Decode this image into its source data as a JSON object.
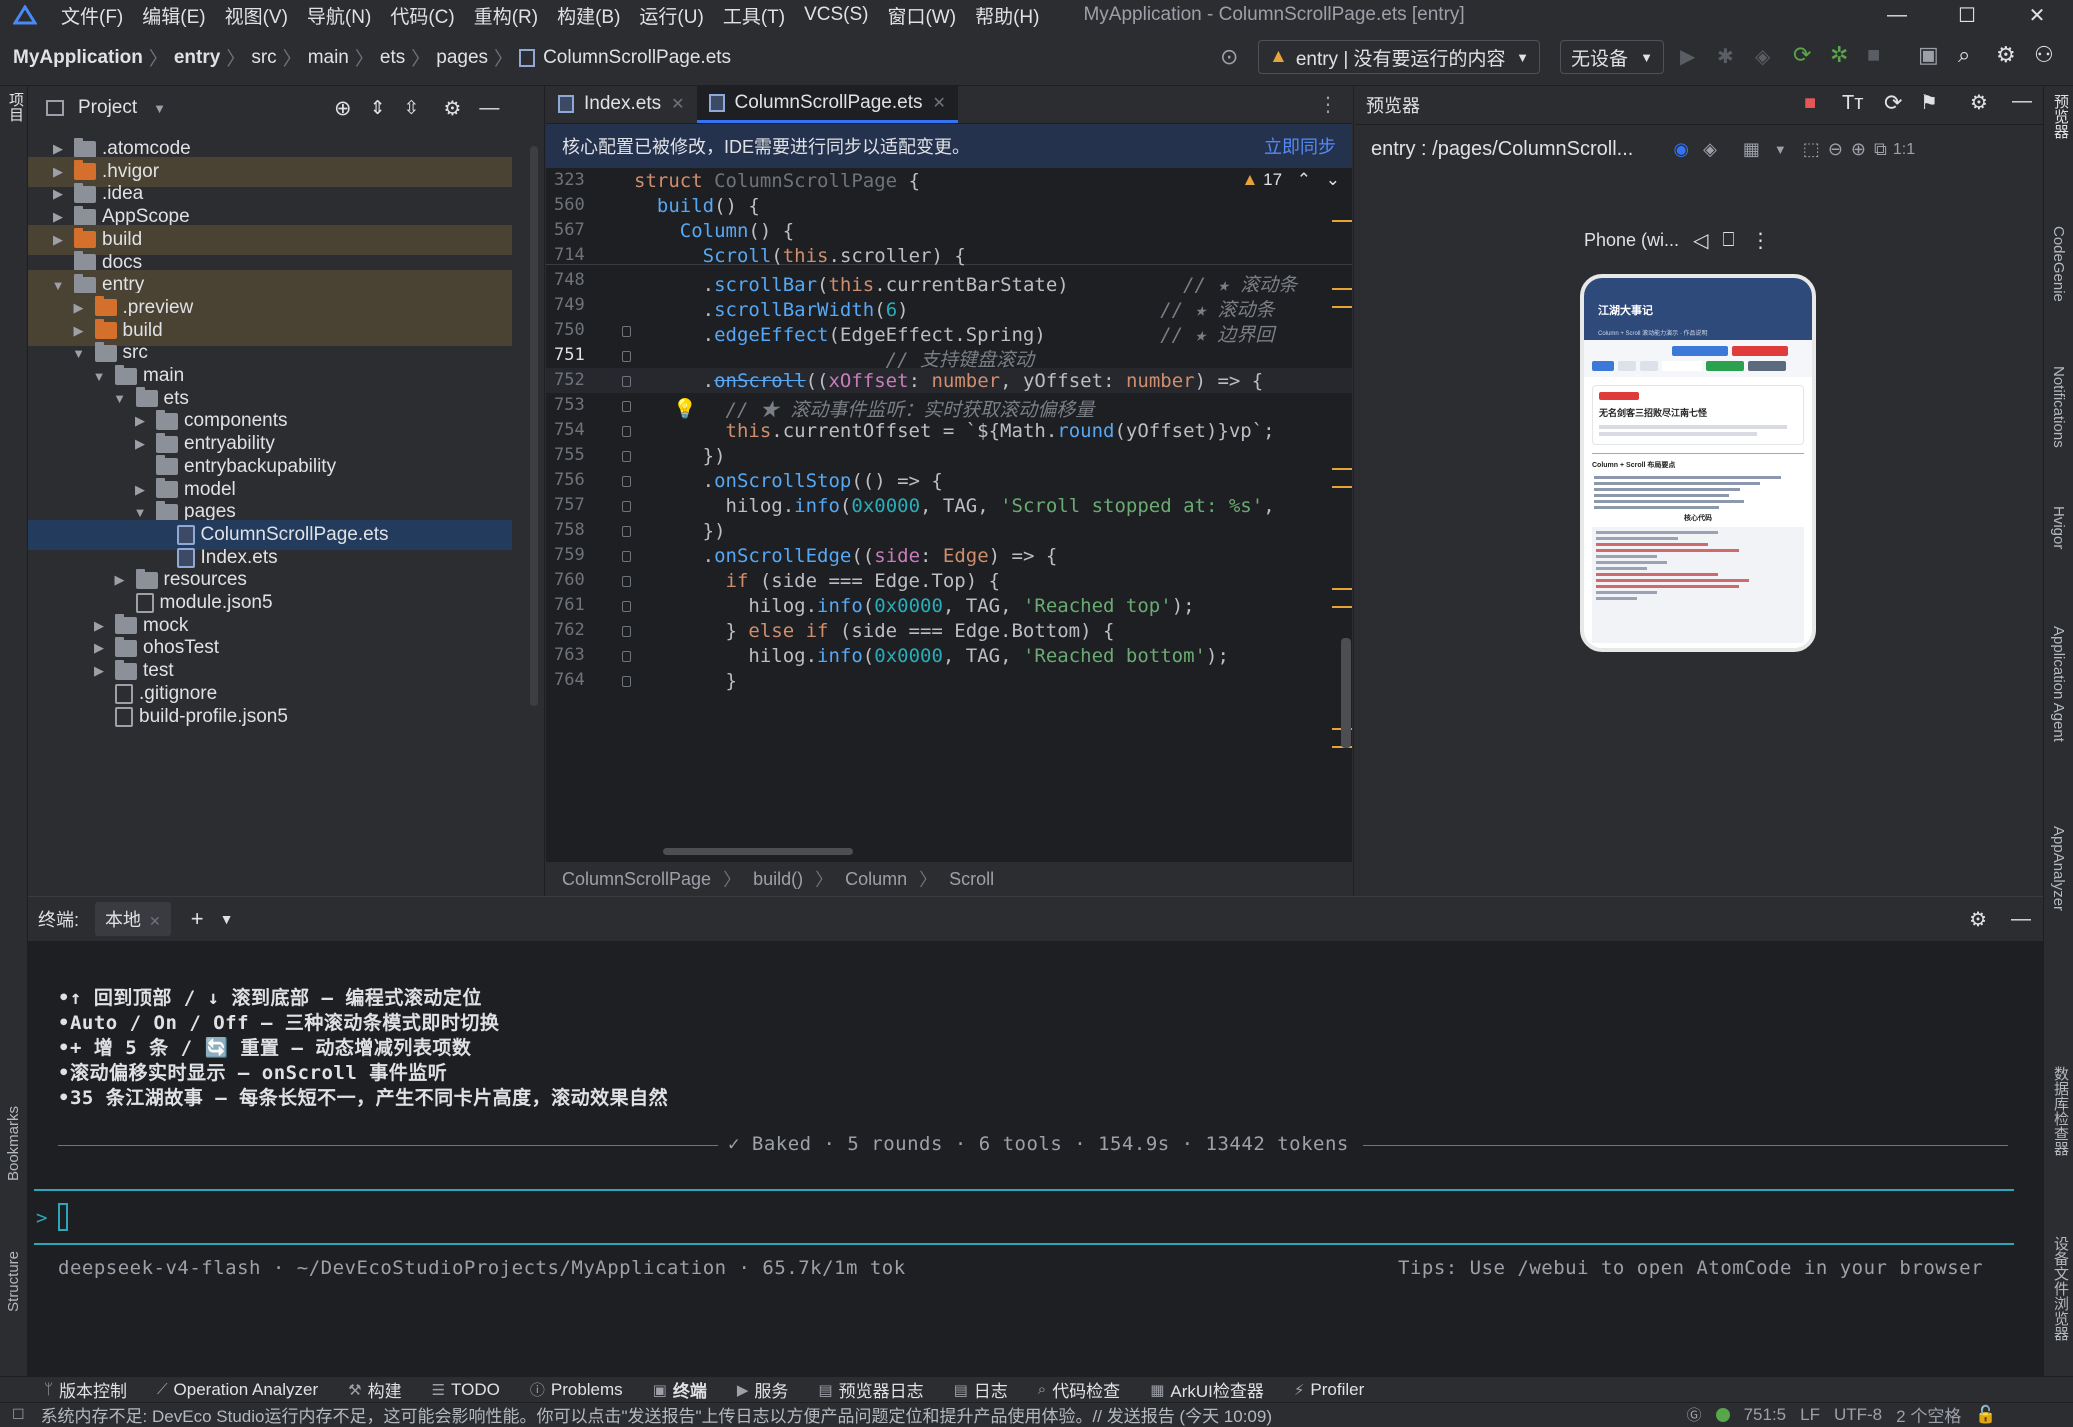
{
  "title_bar": {
    "menu": [
      "文件(F)",
      "编辑(E)",
      "视图(V)",
      "导航(N)",
      "代码(C)",
      "重构(R)",
      "构建(B)",
      "运行(U)",
      "工具(T)",
      "VCS(S)",
      "窗口(W)",
      "帮助(H)"
    ],
    "window_title": "MyApplication - ColumnScrollPage.ets [entry]"
  },
  "nav": {
    "crumbs": [
      "MyApplication",
      "entry",
      "src",
      "main",
      "ets",
      "pages",
      "ColumnScrollPage.ets"
    ],
    "run_config": "entry | 没有要运行的内容",
    "device": "无设备"
  },
  "left_strip": {
    "project_label": "项目",
    "bookmarks": "Bookmarks",
    "structure": "Structure"
  },
  "right_strip": [
    "预览器",
    "CodeGenie",
    "Notifications",
    "Hvigor",
    "Application Agent",
    "AppAnalyzer",
    "数据库检查器",
    "设备文件浏览器"
  ],
  "project": {
    "title": "Project",
    "items": [
      {
        "label": ".atomcode",
        "icon": "gray",
        "depth": 0,
        "arrow": "▶"
      },
      {
        "label": ".hvigor",
        "icon": "orange",
        "depth": 0,
        "arrow": "▶"
      },
      {
        "label": ".idea",
        "icon": "gray",
        "depth": 0,
        "arrow": "▶"
      },
      {
        "label": "AppScope",
        "icon": "gray",
        "depth": 0,
        "arrow": "▶"
      },
      {
        "label": "build",
        "icon": "orange",
        "depth": 0,
        "arrow": "▶"
      },
      {
        "label": "docs",
        "icon": "gray",
        "depth": 0,
        "arrow": ""
      },
      {
        "label": "entry",
        "icon": "gray",
        "depth": 0,
        "arrow": "▼"
      },
      {
        "label": ".preview",
        "icon": "orange",
        "depth": 1,
        "arrow": "▶"
      },
      {
        "label": "build",
        "icon": "orange",
        "depth": 1,
        "arrow": "▶"
      },
      {
        "label": "src",
        "icon": "gray",
        "depth": 1,
        "arrow": "▼"
      },
      {
        "label": "main",
        "icon": "gray",
        "depth": 2,
        "arrow": "▼"
      },
      {
        "label": "ets",
        "icon": "gray",
        "depth": 3,
        "arrow": "▼"
      },
      {
        "label": "components",
        "icon": "gray",
        "depth": 4,
        "arrow": "▶"
      },
      {
        "label": "entryability",
        "icon": "gray",
        "depth": 4,
        "arrow": "▶"
      },
      {
        "label": "entrybackupability",
        "icon": "gray",
        "depth": 4,
        "arrow": ""
      },
      {
        "label": "model",
        "icon": "gray",
        "depth": 4,
        "arrow": "▶"
      },
      {
        "label": "pages",
        "icon": "gray",
        "depth": 4,
        "arrow": "▼"
      },
      {
        "label": "ColumnScrollPage.ets",
        "icon": "ets",
        "depth": 5,
        "arrow": ""
      },
      {
        "label": "Index.ets",
        "icon": "ets",
        "depth": 5,
        "arrow": ""
      },
      {
        "label": "resources",
        "icon": "gray",
        "depth": 3,
        "arrow": "▶"
      },
      {
        "label": "module.json5",
        "icon": "json",
        "depth": 3,
        "arrow": ""
      },
      {
        "label": "mock",
        "icon": "gray",
        "depth": 2,
        "arrow": "▶"
      },
      {
        "label": "ohosTest",
        "icon": "gray",
        "depth": 2,
        "arrow": "▶"
      },
      {
        "label": "test",
        "icon": "gray",
        "depth": 2,
        "arrow": "▶"
      },
      {
        "label": ".gitignore",
        "icon": "json",
        "depth": 2,
        "arrow": ""
      },
      {
        "label": "build-profile.json5",
        "icon": "json",
        "depth": 2,
        "arrow": ""
      }
    ]
  },
  "editor": {
    "tabs": [
      "Index.ets",
      "ColumnScrollPage.ets"
    ],
    "notice": "核心配置已被修改，IDE需要进行同步以适配变更。",
    "notice_action": "立即同步",
    "warnings": "17",
    "breadcrumb": [
      "ColumnScrollPage",
      "build()",
      "Column",
      "Scroll"
    ]
  },
  "preview": {
    "title": "预览器",
    "path": "entry : /pages/ColumnScroll...",
    "device": "Phone (wi...",
    "phone_header": "江湖大事记",
    "phone_sub": "Column + Scroll 滚动能力演示 · 作品说明",
    "story_title": "无名剑客三招败尽江南七怪",
    "card_title": "Column + Scroll 布局要点",
    "core_label": "核心代码"
  },
  "terminal": {
    "label": "终端:",
    "tab": "本地",
    "lines": [
      "•↑ 回到顶部 / ↓ 滚到底部 — 编程式滚动定位",
      "•Auto / On / Off — 三种滚动条模式即时切换",
      "•+ 增 5 条 / 🔄 重置 — 动态增减列表项数",
      "•滚动偏移实时显示 — onScroll 事件监听",
      "•35 条江湖故事 — 每条长短不一，产生不同卡片高度，滚动效果自然"
    ],
    "summary": "✓ Baked · 5 rounds · 6 tools · 154.9s · 13442 tokens",
    "prompt": ">",
    "footer_left": "deepseek-v4-flash · ~/DevEcoStudioProjects/MyApplication · 65.7k/1m tok",
    "footer_right": "Tips: Use /webui to open AtomCode in your browser"
  },
  "toolbar": [
    "版本控制",
    "Operation Analyzer",
    "构建",
    "TODO",
    "Problems",
    "终端",
    "服务",
    "预览器日志",
    "日志",
    "代码检查",
    "ArkUI检查器",
    "Profiler"
  ],
  "status": {
    "message": "系统内存不足: DevEco Studio运行内存不足，这可能会影响性能。你可以点击\"发送报告\"上传日志以方便产品问题定位和提升产品使用体验。// 发送报告 (今天 10:09)",
    "position": "751:5",
    "line_sep": "LF",
    "encoding": "UTF-8",
    "indent": "2 个空格"
  }
}
